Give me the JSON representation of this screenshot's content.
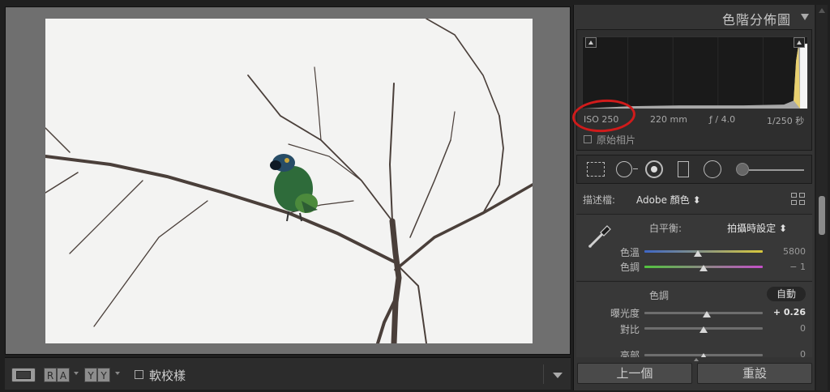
{
  "panel": {
    "title": "色階分佈圖",
    "exif": {
      "iso": "ISO 250",
      "focal": "220 mm",
      "aperture": "ƒ / 4.0",
      "shutter": "1/250 秒"
    },
    "original_photo_label": "原始相片"
  },
  "profile": {
    "label": "描述檔:",
    "value": "Adobe 顏色 ⬍"
  },
  "white_balance": {
    "label": "白平衡:",
    "value": "拍攝時設定 ⬍"
  },
  "sliders": {
    "temp": {
      "label": "色溫",
      "value": "5800",
      "position": 0.45
    },
    "tint": {
      "label": "色調",
      "value": "− 1",
      "position": 0.5
    },
    "exposure": {
      "label": "曝光度",
      "value": "+ 0.26",
      "position": 0.53
    },
    "contrast": {
      "label": "對比",
      "value": "0",
      "position": 0.5
    },
    "highlights": {
      "label": "亮部",
      "value": "0",
      "position": 0.5
    }
  },
  "tone": {
    "label": "色調",
    "auto_label": "自動"
  },
  "buttons": {
    "previous": "上一個",
    "reset": "重設"
  },
  "toolbar": {
    "softproof_label": "軟校樣",
    "before_after_1": [
      "R",
      "A"
    ],
    "before_after_2": [
      "Y",
      "Y"
    ]
  },
  "colors": {
    "annotation": "#d01b1b",
    "temp_track": "#4a78c8",
    "tint_track": "#7ec84a"
  }
}
